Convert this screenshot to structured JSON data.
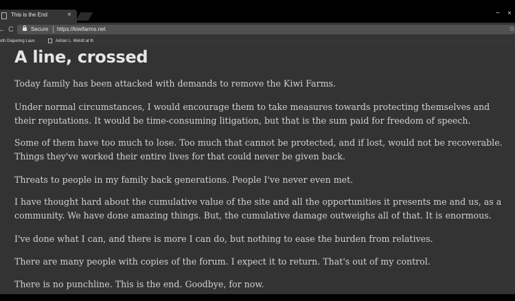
{
  "tab": {
    "title": "This is the End",
    "close": "×"
  },
  "window_controls": {
    "minimize": "−",
    "close": "×"
  },
  "nav": {
    "back": "←",
    "reload": "C"
  },
  "address": {
    "secure_label": "Secure",
    "url": "https://kiwifarms.net",
    "star": "☆"
  },
  "bookmarks": [
    {
      "label": "oth Diapering Laun"
    },
    {
      "label": "Adrian L. Melott at th"
    }
  ],
  "article": {
    "heading": "A line, crossed",
    "paragraphs": [
      "Today family has been attacked with demands to remove the Kiwi Farms.",
      "Under normal circumstances, I would encourage them to take measures towards protecting themselves and their reputations. It would be time-consuming litigation, but that is the sum paid for freedom of speech.",
      "Some of them have too much to lose. Too much that cannot be protected, and if lost, would not be recoverable. Things they've worked their entire lives for that could never be given back.",
      "Threats to people in my family back generations. People I've never even met.",
      "I have thought hard about the cumulative value of the site and all the opportunities it presents me and us, as a community. We have done amazing things. But, the cumulative damage outweighs all of that. It is enormous.",
      "I've done what I can, and there is more I can do, but nothing to ease the burden from relatives.",
      "There are many people with copies of the forum. I expect it to return. That's out of my control.",
      "There is no punchline. This is the end. Goodbye, for now."
    ]
  }
}
